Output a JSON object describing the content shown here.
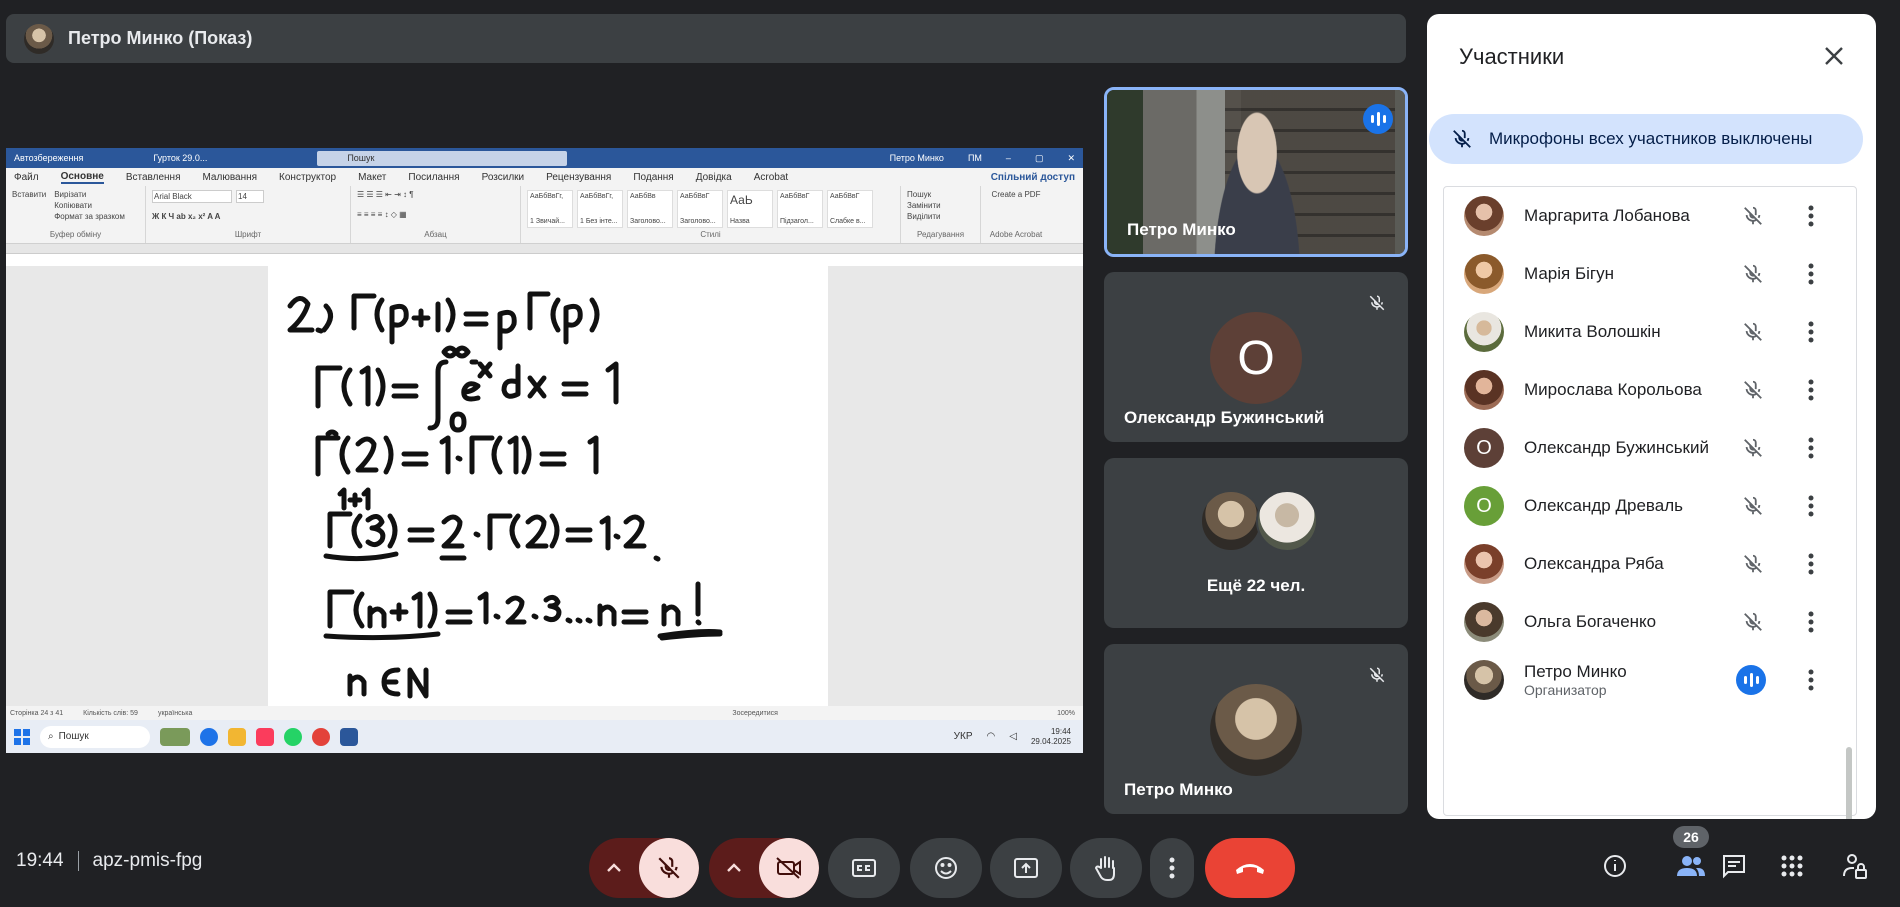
{
  "presenter_bar": {
    "title": "Петро Минко (Показ)"
  },
  "word": {
    "autosave": "Автозбереження",
    "doc_name": "Гурток 29.0...",
    "search": "Пошук",
    "user": "Петро Минко",
    "user_initials": "ПМ",
    "tabs": [
      "Файл",
      "Основне",
      "Вставлення",
      "Малювання",
      "Конструктор",
      "Макет",
      "Посилання",
      "Розсилки",
      "Рецензування",
      "Подання",
      "Довідка",
      "Acrobat"
    ],
    "share": "Спільний доступ",
    "ribbon": {
      "paste": "Вставити",
      "cut": "Вирізати",
      "copy": "Копіювати",
      "format_painter": "Формат за зразком",
      "clipboard": "Буфер обміну",
      "font_name": "Arial Black",
      "font_size": "14",
      "font_group": "Шрифт",
      "paragraph_group": "Абзац",
      "styles_group": "Стилі",
      "styles": [
        "1 Звичай...",
        "1 Без інте...",
        "Заголово...",
        "Заголово...",
        "Назва",
        "Підзагол...",
        "Слабке в..."
      ],
      "style_samples": [
        "АаБбВвГг,",
        "АаБбВвГг,",
        "АаБбВв",
        "АаБбВвГ",
        "АаЬ",
        "АаБбВвГ",
        "АаБбВвГ"
      ],
      "find": "Пошук",
      "replace": "Замінити",
      "select": "Виділити",
      "editing_group": "Редагування",
      "create_pdf": "Create a PDF",
      "acrobat_group": "Adobe Acrobat"
    },
    "status": {
      "page": "Сторінка 24 з 41",
      "words": "Кількість слів: 59",
      "lang": "українська",
      "focus": "Зосередитися",
      "zoom": "100%"
    },
    "taskbar": {
      "search": "Пошук",
      "lang": "УКР",
      "time": "19:44",
      "date": "29.04.2025"
    }
  },
  "tiles": [
    {
      "name": "Петро Минко",
      "speaking": true
    },
    {
      "name": "Олександр Бужинський",
      "initial": "О",
      "muted": true
    },
    {
      "more_label": "Ещё 22 чел."
    },
    {
      "name": "Петро Минко",
      "muted": true
    }
  ],
  "participants": {
    "title": "Участники",
    "banner": "Микрофоны всех участников выключены",
    "list": [
      {
        "name": "Маргарита Лобанова",
        "kind": "photo"
      },
      {
        "name": "Марія Бігун",
        "kind": "photo"
      },
      {
        "name": "Микита Волошкін",
        "kind": "photo"
      },
      {
        "name": "Мирослава Корольова",
        "kind": "photo"
      },
      {
        "name": "Олександр Бужинський",
        "kind": "initial",
        "initial": "О",
        "color": "#5d4037"
      },
      {
        "name": "Олександр Древаль",
        "kind": "initial",
        "initial": "О",
        "color": "#689f38"
      },
      {
        "name": "Олександра Ряба",
        "kind": "photo"
      },
      {
        "name": "Ольга Богаченко",
        "kind": "photo"
      },
      {
        "name": "Петро Минко",
        "role": "Организатор",
        "kind": "photo",
        "speaking": true
      }
    ]
  },
  "bottom": {
    "time": "19:44",
    "meeting_code": "apz-pmis-fpg",
    "participant_count": "26"
  },
  "colors": {
    "accent": "#1a73e8",
    "hangup": "#ea4335",
    "muted_bg": "#f9dedc"
  }
}
